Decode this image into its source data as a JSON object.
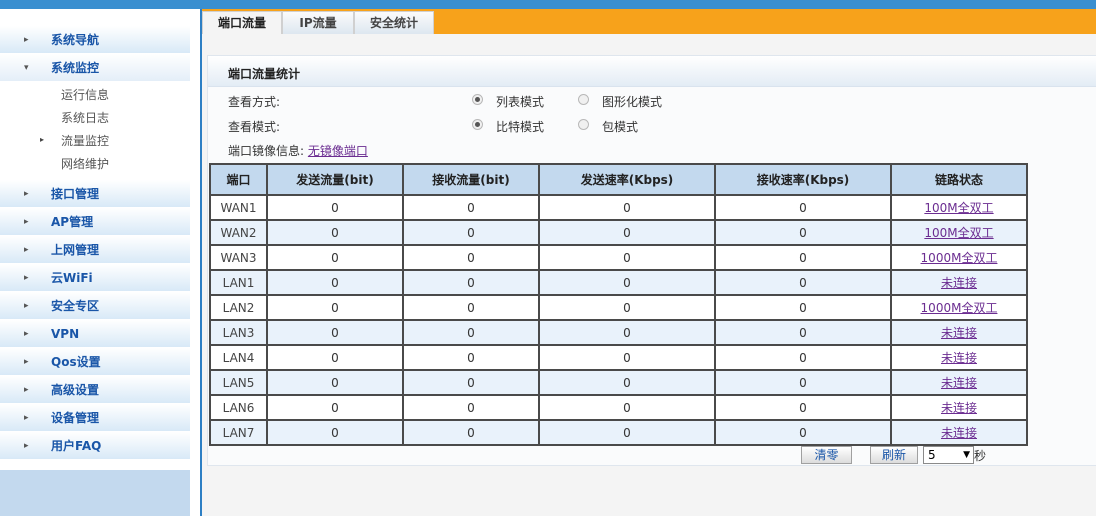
{
  "sidebar": {
    "items": [
      {
        "label": "系统导航"
      },
      {
        "label": "系统监控"
      },
      {
        "label": "接口管理"
      },
      {
        "label": "AP管理"
      },
      {
        "label": "上网管理"
      },
      {
        "label": "云WiFi"
      },
      {
        "label": "安全专区"
      },
      {
        "label": "VPN"
      },
      {
        "label": "Qos设置"
      },
      {
        "label": "高级设置"
      },
      {
        "label": "设备管理"
      },
      {
        "label": "用户FAQ"
      }
    ],
    "monitor_sub": [
      {
        "label": "运行信息"
      },
      {
        "label": "系统日志"
      },
      {
        "label": "流量监控"
      },
      {
        "label": "网络维护"
      }
    ]
  },
  "tabs": [
    {
      "label": "端口流量"
    },
    {
      "label": "IP流量"
    },
    {
      "label": "安全统计"
    }
  ],
  "panel": {
    "title": "端口流量统计",
    "view_mode_label": "查看方式:",
    "view_mode_options": [
      "列表模式",
      "图形化模式"
    ],
    "view_mode_selected": "列表模式",
    "count_mode_label": "查看模式:",
    "count_mode_options": [
      "比特模式",
      "包模式"
    ],
    "count_mode_selected": "比特模式",
    "mirror_label": "端口镜像信息:",
    "mirror_value": "无镜像端口"
  },
  "table": {
    "headers": [
      "端口",
      "发送流量(bit)",
      "接收流量(bit)",
      "发送速率(Kbps)",
      "接收速率(Kbps)",
      "链路状态"
    ],
    "rows": [
      {
        "port": "WAN1",
        "tx": "0",
        "rx": "0",
        "tx_rate": "0",
        "rx_rate": "0",
        "status": "100M全双工"
      },
      {
        "port": "WAN2",
        "tx": "0",
        "rx": "0",
        "tx_rate": "0",
        "rx_rate": "0",
        "status": "100M全双工"
      },
      {
        "port": "WAN3",
        "tx": "0",
        "rx": "0",
        "tx_rate": "0",
        "rx_rate": "0",
        "status": "1000M全双工"
      },
      {
        "port": "LAN1",
        "tx": "0",
        "rx": "0",
        "tx_rate": "0",
        "rx_rate": "0",
        "status": "未连接"
      },
      {
        "port": "LAN2",
        "tx": "0",
        "rx": "0",
        "tx_rate": "0",
        "rx_rate": "0",
        "status": "1000M全双工"
      },
      {
        "port": "LAN3",
        "tx": "0",
        "rx": "0",
        "tx_rate": "0",
        "rx_rate": "0",
        "status": "未连接"
      },
      {
        "port": "LAN4",
        "tx": "0",
        "rx": "0",
        "tx_rate": "0",
        "rx_rate": "0",
        "status": "未连接"
      },
      {
        "port": "LAN5",
        "tx": "0",
        "rx": "0",
        "tx_rate": "0",
        "rx_rate": "0",
        "status": "未连接"
      },
      {
        "port": "LAN6",
        "tx": "0",
        "rx": "0",
        "tx_rate": "0",
        "rx_rate": "0",
        "status": "未连接"
      },
      {
        "port": "LAN7",
        "tx": "0",
        "rx": "0",
        "tx_rate": "0",
        "rx_rate": "0",
        "status": "未连接"
      }
    ]
  },
  "controls": {
    "clear_label": "清零",
    "refresh_label": "刷新",
    "interval_value": "5",
    "interval_unit": "秒"
  },
  "colors": {
    "accent_blue": "#3a8fd0",
    "tab_orange": "#f7a21b",
    "header_blue": "#c3d9ee",
    "link_purple": "#6b2d91"
  }
}
